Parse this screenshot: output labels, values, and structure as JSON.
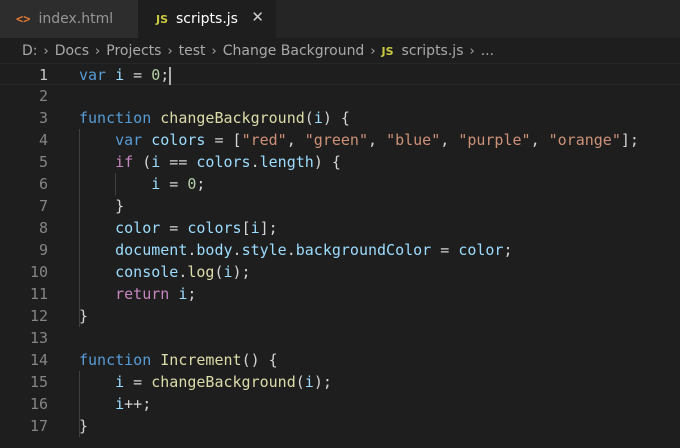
{
  "tabs": [
    {
      "icon": "<>",
      "label": "index.html"
    },
    {
      "icon": "JS",
      "label": "scripts.js",
      "close": "✕"
    }
  ],
  "breadcrumb": {
    "items": [
      "D:",
      "Docs",
      "Projects",
      "test",
      "Change Background"
    ],
    "file_icon": "JS",
    "file": "scripts.js",
    "tail": "...",
    "separator": "›"
  },
  "editor": {
    "current_line": 1,
    "lines": [
      {
        "n": "1",
        "tokens": [
          [
            "kw",
            "var"
          ],
          [
            "pn",
            " "
          ],
          [
            "var",
            "i"
          ],
          [
            "pn",
            " = "
          ],
          [
            "num",
            "0"
          ],
          [
            "pn",
            ";"
          ]
        ]
      },
      {
        "n": "2",
        "tokens": []
      },
      {
        "n": "3",
        "tokens": [
          [
            "kw",
            "function"
          ],
          [
            "pn",
            " "
          ],
          [
            "fn",
            "changeBackground"
          ],
          [
            "pn",
            "("
          ],
          [
            "var",
            "i"
          ],
          [
            "pn",
            ") {"
          ]
        ]
      },
      {
        "n": "4",
        "tokens": [
          [
            "pn",
            "    "
          ],
          [
            "kw",
            "var"
          ],
          [
            "pn",
            " "
          ],
          [
            "var",
            "colors"
          ],
          [
            "pn",
            " = ["
          ],
          [
            "str",
            "\"red\""
          ],
          [
            "pn",
            ", "
          ],
          [
            "str",
            "\"green\""
          ],
          [
            "pn",
            ", "
          ],
          [
            "str",
            "\"blue\""
          ],
          [
            "pn",
            ", "
          ],
          [
            "str",
            "\"purple\""
          ],
          [
            "pn",
            ", "
          ],
          [
            "str",
            "\"orange\""
          ],
          [
            "pn",
            "];"
          ]
        ]
      },
      {
        "n": "5",
        "tokens": [
          [
            "pn",
            "    "
          ],
          [
            "kw2",
            "if"
          ],
          [
            "pn",
            " ("
          ],
          [
            "var",
            "i"
          ],
          [
            "pn",
            " == "
          ],
          [
            "var",
            "colors"
          ],
          [
            "pn",
            "."
          ],
          [
            "var",
            "length"
          ],
          [
            "pn",
            ") {"
          ]
        ]
      },
      {
        "n": "6",
        "tokens": [
          [
            "pn",
            "        "
          ],
          [
            "var",
            "i"
          ],
          [
            "pn",
            " = "
          ],
          [
            "num",
            "0"
          ],
          [
            "pn",
            ";"
          ]
        ]
      },
      {
        "n": "7",
        "tokens": [
          [
            "pn",
            "    }"
          ]
        ]
      },
      {
        "n": "8",
        "tokens": [
          [
            "pn",
            "    "
          ],
          [
            "var",
            "color"
          ],
          [
            "pn",
            " = "
          ],
          [
            "var",
            "colors"
          ],
          [
            "pn",
            "["
          ],
          [
            "var",
            "i"
          ],
          [
            "pn",
            "];"
          ]
        ]
      },
      {
        "n": "9",
        "tokens": [
          [
            "pn",
            "    "
          ],
          [
            "var",
            "document"
          ],
          [
            "pn",
            "."
          ],
          [
            "var",
            "body"
          ],
          [
            "pn",
            "."
          ],
          [
            "var",
            "style"
          ],
          [
            "pn",
            "."
          ],
          [
            "var",
            "backgroundColor"
          ],
          [
            "pn",
            " = "
          ],
          [
            "var",
            "color"
          ],
          [
            "pn",
            ";"
          ]
        ]
      },
      {
        "n": "10",
        "tokens": [
          [
            "pn",
            "    "
          ],
          [
            "var",
            "console"
          ],
          [
            "pn",
            "."
          ],
          [
            "fn",
            "log"
          ],
          [
            "pn",
            "("
          ],
          [
            "var",
            "i"
          ],
          [
            "pn",
            ");"
          ]
        ]
      },
      {
        "n": "11",
        "tokens": [
          [
            "pn",
            "    "
          ],
          [
            "kw2",
            "return"
          ],
          [
            "pn",
            " "
          ],
          [
            "var",
            "i"
          ],
          [
            "pn",
            ";"
          ]
        ]
      },
      {
        "n": "12",
        "tokens": [
          [
            "pn",
            "}"
          ]
        ]
      },
      {
        "n": "13",
        "tokens": []
      },
      {
        "n": "14",
        "tokens": [
          [
            "kw",
            "function"
          ],
          [
            "pn",
            " "
          ],
          [
            "fn",
            "Increment"
          ],
          [
            "pn",
            "() {"
          ]
        ]
      },
      {
        "n": "15",
        "tokens": [
          [
            "pn",
            "    "
          ],
          [
            "var",
            "i"
          ],
          [
            "pn",
            " = "
          ],
          [
            "fn",
            "changeBackground"
          ],
          [
            "pn",
            "("
          ],
          [
            "var",
            "i"
          ],
          [
            "pn",
            ");"
          ]
        ]
      },
      {
        "n": "16",
        "tokens": [
          [
            "pn",
            "    "
          ],
          [
            "var",
            "i"
          ],
          [
            "pn",
            "++;"
          ]
        ]
      },
      {
        "n": "17",
        "tokens": [
          [
            "pn",
            "}"
          ]
        ]
      }
    ]
  }
}
